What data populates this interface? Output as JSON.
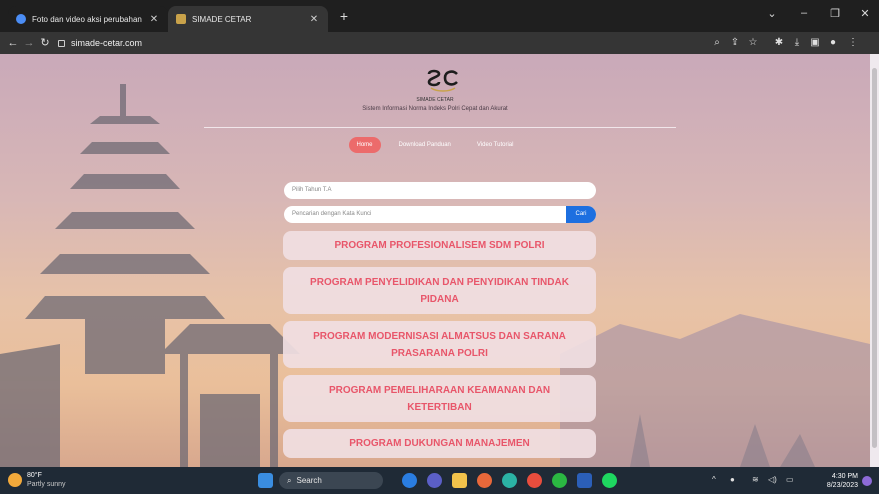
{
  "browser": {
    "tabs": [
      {
        "title": "Foto dan video aksi perubahan",
        "close": "✕",
        "active": false,
        "favicon_color": "#4b8df5"
      },
      {
        "title": "SIMADE CETAR",
        "close": "✕",
        "active": true,
        "favicon_color": "#c9a24a"
      }
    ],
    "new_tab": "+",
    "url": "simade-cetar.com",
    "window_controls": {
      "minimize": "–",
      "maximize": "❐",
      "close": "✕",
      "tab_search": "⌄"
    }
  },
  "site": {
    "logo_text": "SIMADE CETAR",
    "subtitle": "Sistem Informasi Norma Indeks Polri Cepat dan Akurat",
    "nav": [
      {
        "label": "Home",
        "active": true
      },
      {
        "label": "Download Panduan",
        "active": false
      },
      {
        "label": "Video Tutorial",
        "active": false
      }
    ],
    "year_select_placeholder": "Pilih Tahun T.A",
    "search_placeholder": "Pencarian dengan Kata Kunci",
    "search_button": "Cari",
    "programs": [
      "PROGRAM PROFESIONALISEM SDM POLRI",
      "PROGRAM PENYELIDIKAN DAN PENYIDIKAN TINDAK PIDANA",
      "PROGRAM MODERNISASI ALMATSUS DAN SARANA PRASARANA POLRI",
      "PROGRAM PEMELIHARAAN KEAMANAN DAN KETERTIBAN",
      "PROGRAM DUKUNGAN MANAJEMEN"
    ]
  },
  "taskbar": {
    "weather_temp": "80°F",
    "weather_desc": "Partly sunny",
    "search_label": "Search",
    "time": "4:30 PM",
    "date": "8/23/2023"
  },
  "colors": {
    "accent": "#e8566a",
    "nav_active": "#ec6b6b",
    "search_button": "#1d6fe0"
  }
}
